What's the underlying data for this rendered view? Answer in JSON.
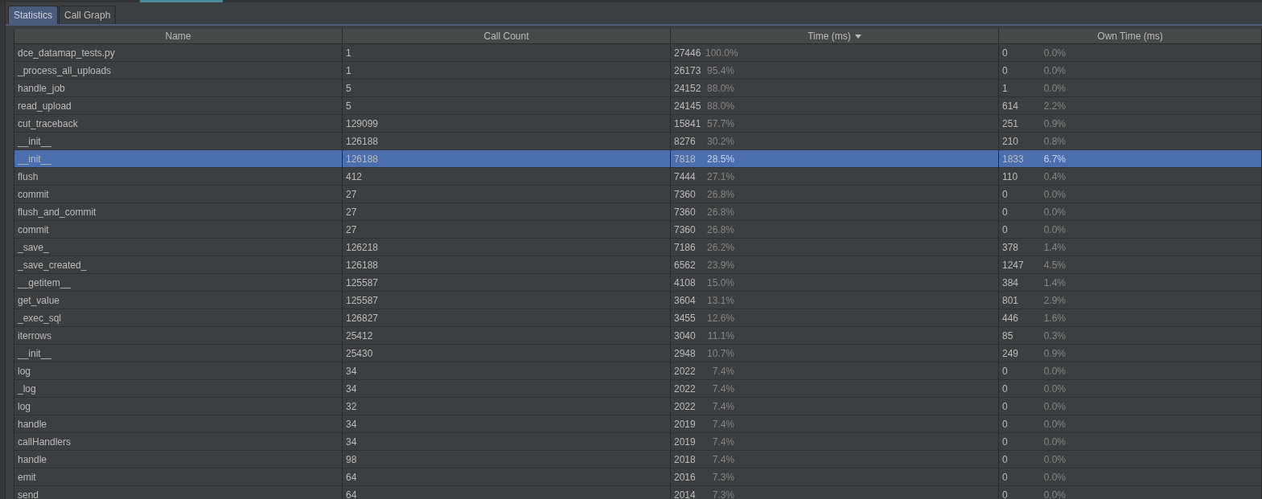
{
  "tabs": [
    {
      "label": "Statistics",
      "selected": true
    },
    {
      "label": "Call Graph",
      "selected": false
    }
  ],
  "table": {
    "columns": [
      {
        "label": "Name",
        "sorted": false
      },
      {
        "label": "Call Count",
        "sorted": false
      },
      {
        "label": "Time (ms)",
        "sorted": true
      },
      {
        "label": "Own Time (ms)",
        "sorted": false
      }
    ],
    "rows": [
      {
        "name": "dce_datamap_tests.py",
        "calls": "1",
        "time": "27446",
        "time_pct": "100.0%",
        "own": "0",
        "own_pct": "0.0%",
        "selected": false
      },
      {
        "name": "_process_all_uploads",
        "calls": "1",
        "time": "26173",
        "time_pct": "95.4%",
        "own": "0",
        "own_pct": "0.0%",
        "selected": false
      },
      {
        "name": "handle_job",
        "calls": "5",
        "time": "24152",
        "time_pct": "88.0%",
        "own": "1",
        "own_pct": "0.0%",
        "selected": false
      },
      {
        "name": "read_upload",
        "calls": "5",
        "time": "24145",
        "time_pct": "88.0%",
        "own": "614",
        "own_pct": "2.2%",
        "selected": false
      },
      {
        "name": "cut_traceback",
        "calls": "129099",
        "time": "15841",
        "time_pct": "57.7%",
        "own": "251",
        "own_pct": "0.9%",
        "selected": false
      },
      {
        "name": "__init__",
        "calls": "126188",
        "time": "8276",
        "time_pct": "30.2%",
        "own": "210",
        "own_pct": "0.8%",
        "selected": false
      },
      {
        "name": "__init__",
        "calls": "126188",
        "time": "7818",
        "time_pct": "28.5%",
        "own": "1833",
        "own_pct": "6.7%",
        "selected": true
      },
      {
        "name": "flush",
        "calls": "412",
        "time": "7444",
        "time_pct": "27.1%",
        "own": "110",
        "own_pct": "0.4%",
        "selected": false
      },
      {
        "name": "commit",
        "calls": "27",
        "time": "7360",
        "time_pct": "26.8%",
        "own": "0",
        "own_pct": "0.0%",
        "selected": false
      },
      {
        "name": "flush_and_commit",
        "calls": "27",
        "time": "7360",
        "time_pct": "26.8%",
        "own": "0",
        "own_pct": "0.0%",
        "selected": false
      },
      {
        "name": "commit",
        "calls": "27",
        "time": "7360",
        "time_pct": "26.8%",
        "own": "0",
        "own_pct": "0.0%",
        "selected": false
      },
      {
        "name": "_save_",
        "calls": "126218",
        "time": "7186",
        "time_pct": "26.2%",
        "own": "378",
        "own_pct": "1.4%",
        "selected": false
      },
      {
        "name": "_save_created_",
        "calls": "126188",
        "time": "6562",
        "time_pct": "23.9%",
        "own": "1247",
        "own_pct": "4.5%",
        "selected": false
      },
      {
        "name": "__getitem__",
        "calls": "125587",
        "time": "4108",
        "time_pct": "15.0%",
        "own": "384",
        "own_pct": "1.4%",
        "selected": false
      },
      {
        "name": "get_value",
        "calls": "125587",
        "time": "3604",
        "time_pct": "13.1%",
        "own": "801",
        "own_pct": "2.9%",
        "selected": false
      },
      {
        "name": "_exec_sql",
        "calls": "126827",
        "time": "3455",
        "time_pct": "12.6%",
        "own": "446",
        "own_pct": "1.6%",
        "selected": false
      },
      {
        "name": "iterrows",
        "calls": "25412",
        "time": "3040",
        "time_pct": "11.1%",
        "own": "85",
        "own_pct": "0.3%",
        "selected": false
      },
      {
        "name": "__init__",
        "calls": "25430",
        "time": "2948",
        "time_pct": "10.7%",
        "own": "249",
        "own_pct": "0.9%",
        "selected": false
      },
      {
        "name": "log",
        "calls": "34",
        "time": "2022",
        "time_pct": "7.4%",
        "own": "0",
        "own_pct": "0.0%",
        "selected": false
      },
      {
        "name": "_log",
        "calls": "34",
        "time": "2022",
        "time_pct": "7.4%",
        "own": "0",
        "own_pct": "0.0%",
        "selected": false
      },
      {
        "name": "log",
        "calls": "32",
        "time": "2022",
        "time_pct": "7.4%",
        "own": "0",
        "own_pct": "0.0%",
        "selected": false
      },
      {
        "name": "handle",
        "calls": "34",
        "time": "2019",
        "time_pct": "7.4%",
        "own": "0",
        "own_pct": "0.0%",
        "selected": false
      },
      {
        "name": "callHandlers",
        "calls": "34",
        "time": "2019",
        "time_pct": "7.4%",
        "own": "0",
        "own_pct": "0.0%",
        "selected": false
      },
      {
        "name": "handle",
        "calls": "98",
        "time": "2018",
        "time_pct": "7.4%",
        "own": "0",
        "own_pct": "0.0%",
        "selected": false
      },
      {
        "name": "emit",
        "calls": "64",
        "time": "2016",
        "time_pct": "7.3%",
        "own": "0",
        "own_pct": "0.0%",
        "selected": false
      },
      {
        "name": "send",
        "calls": "64",
        "time": "2014",
        "time_pct": "7.3%",
        "own": "0",
        "own_pct": "0.0%",
        "selected": false
      }
    ]
  }
}
